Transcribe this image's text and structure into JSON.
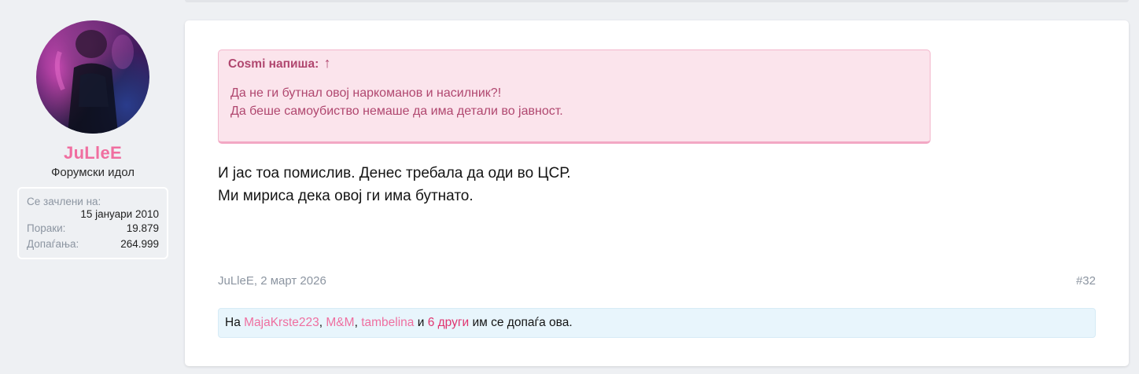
{
  "user": {
    "username": "JuLleE",
    "title": "Форумски идол",
    "avatar_icon": "user-avatar-photo",
    "stats": {
      "joined_label": "Се зачлени на:",
      "joined_value": "15 јануари 2010",
      "posts_label": "Пораки:",
      "posts_value": "19.879",
      "likes_label": "Допаѓања:",
      "likes_value": "264.999"
    }
  },
  "post": {
    "quote": {
      "author_line": "Cosmi напиша:",
      "jump_icon": "↑",
      "lines": [
        "Да не ги бутнал овој наркоманов и насилник?!",
        "Да беше самоубиство немаше да има детали во јавност."
      ]
    },
    "message_lines": [
      "И јас тоа помислив. Денес требала да оди во ЦСР.",
      "Ми мириса дека овој ги има бутнато."
    ],
    "meta": {
      "author_date": "JuLleE, 2 март 2026",
      "post_number": "#32"
    },
    "likes": {
      "prefix": "На ",
      "users": [
        "MajaKrste223",
        "M&M",
        "tambelina"
      ],
      "separator": ", ",
      "conjunction": " и ",
      "others": "6 други",
      "suffix": " им се допаѓа ова."
    }
  },
  "colors": {
    "username": "#f06ea0",
    "quote_bg": "#fbe4ec",
    "quote_text": "#b0476f",
    "likes_bg": "#e8f5fc",
    "like_user_link": "#ef6fa0",
    "others_link": "#e0346f"
  }
}
